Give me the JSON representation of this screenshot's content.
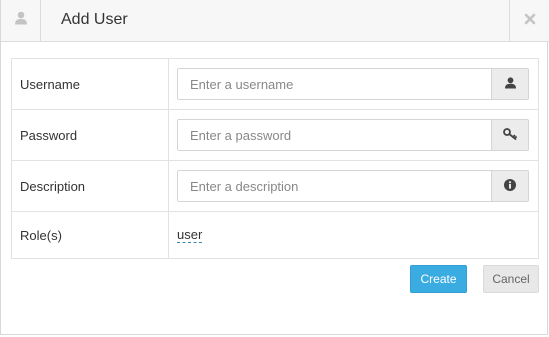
{
  "dialog": {
    "title": "Add User",
    "header_icon": "user-icon",
    "close_icon": "close-icon"
  },
  "form": {
    "username": {
      "label": "Username",
      "placeholder": "Enter a username",
      "icon": "user-icon"
    },
    "password": {
      "label": "Password",
      "placeholder": "Enter a password",
      "icon": "key-icon"
    },
    "description": {
      "label": "Description",
      "placeholder": "Enter a description",
      "icon": "info-icon"
    },
    "roles": {
      "label": "Role(s)",
      "value": "user"
    }
  },
  "buttons": {
    "create": "Create",
    "cancel": "Cancel"
  },
  "colors": {
    "primary": "#3bace2",
    "header_bg": "#f7f7f7",
    "addon_bg": "#ececec",
    "link_dash": "#3a87ad"
  }
}
